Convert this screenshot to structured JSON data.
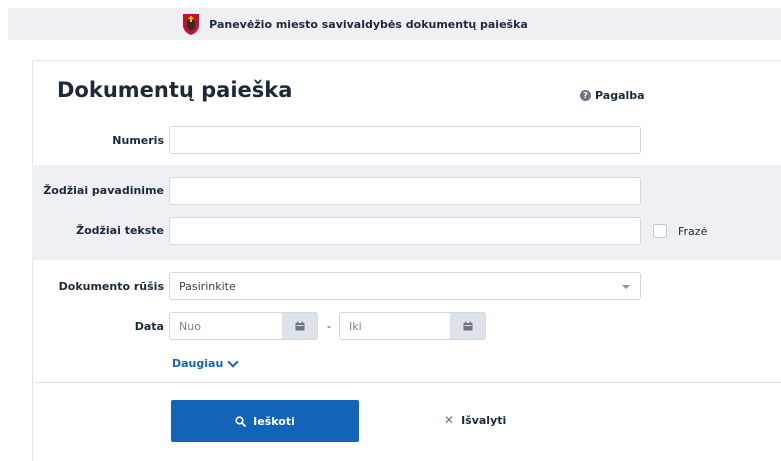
{
  "header": {
    "crest_icon": "city-coat-of-arms-icon",
    "title": "Panevėžio miesto savivaldybės dokumentų paieška"
  },
  "page": {
    "title": "Dokumentų paieška",
    "help_label": "Pagalba",
    "help_icon": "question-circle-icon"
  },
  "form": {
    "number": {
      "label": "Numeris",
      "value": ""
    },
    "title_words": {
      "label": "Žodžiai pavadinime",
      "value": ""
    },
    "text_words": {
      "label": "Žodžiai tekste",
      "value": ""
    },
    "phrase": {
      "label": "Frazė",
      "checked": false
    },
    "doc_type": {
      "label": "Dokumento rūšis",
      "selected": "Pasirinkite"
    },
    "date": {
      "label": "Data",
      "from_placeholder": "Nuo",
      "to_placeholder": "Iki",
      "separator": "-",
      "calendar_icon": "calendar-icon"
    },
    "more_label": "Daugiau",
    "search_label": "Ieškoti",
    "search_icon": "magnifier-icon",
    "clear_label": "Išvalyti",
    "clear_icon": "close-icon"
  },
  "colors": {
    "primary": "#1363b8",
    "band": "#eef0f4",
    "text": "#1b2a3a"
  }
}
